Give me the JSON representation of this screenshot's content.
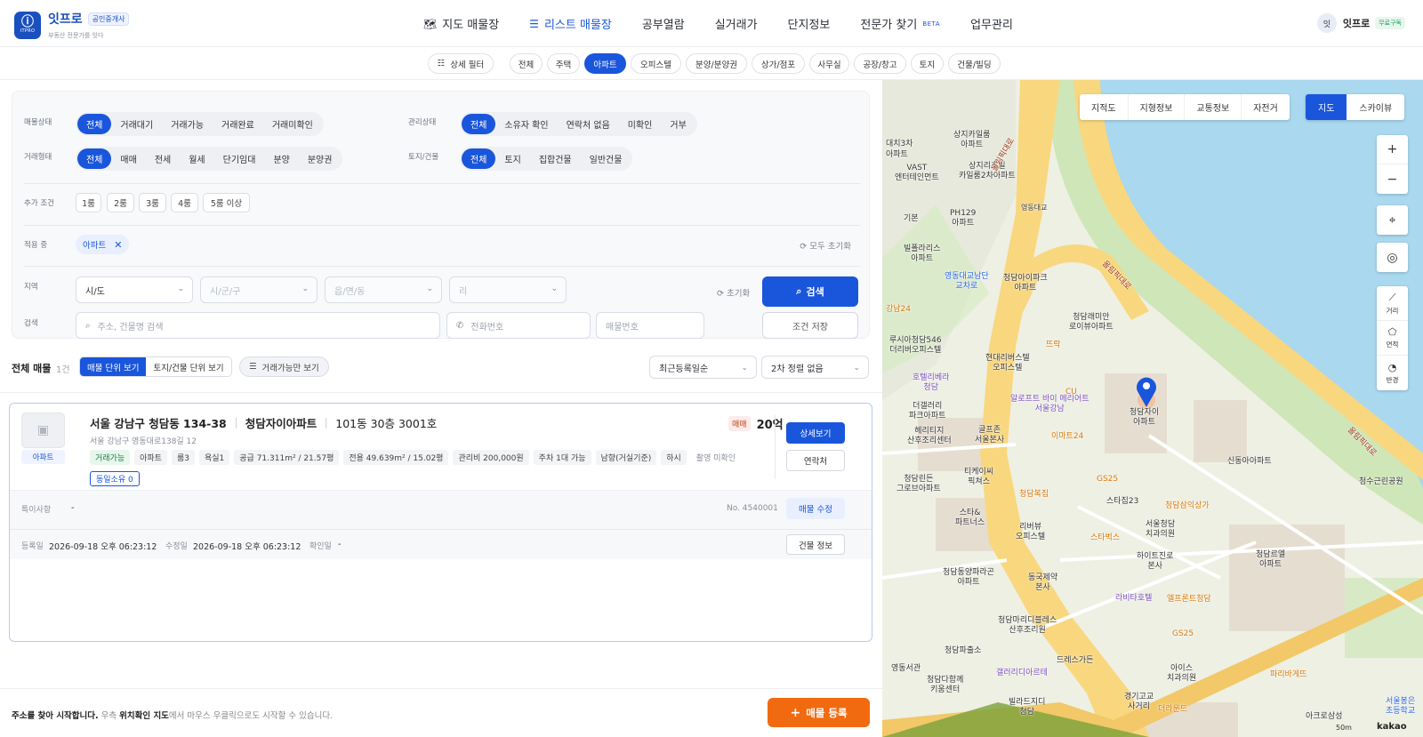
{
  "brand": {
    "name": "잇프로",
    "badge": "공인중개사",
    "tagline": "부동산 전문가를 잇다",
    "logo_text": "ITPRO"
  },
  "nav": [
    {
      "label": "지도 매물장",
      "icon": "map-icon"
    },
    {
      "label": "리스트 매물장",
      "icon": "list-icon",
      "active": true
    },
    {
      "label": "공부열람"
    },
    {
      "label": "실거래가"
    },
    {
      "label": "단지정보"
    },
    {
      "label": "전문가 찾기",
      "badge": "BETA"
    },
    {
      "label": "업무관리"
    }
  ],
  "user": {
    "avatar": "잇",
    "name": "잇프로",
    "plan": "무료구독"
  },
  "categories": {
    "detail_filter": "상세 필터",
    "items": [
      "전체",
      "주택",
      "아파트",
      "오피스텔",
      "분양/분양권",
      "상가/점포",
      "사무실",
      "공장/창고",
      "토지",
      "건물/빌딩"
    ],
    "active": "아파트"
  },
  "filters": {
    "status": {
      "label": "매물상태",
      "options": [
        "전체",
        "거래대기",
        "거래가능",
        "거래완료",
        "거래미확인"
      ]
    },
    "manage": {
      "label": "관리상태",
      "options": [
        "전체",
        "소유자 확인",
        "연락처 없음",
        "미확인",
        "거부"
      ]
    },
    "deal": {
      "label": "거래형태",
      "options": [
        "전체",
        "매매",
        "전세",
        "월세",
        "단기임대",
        "분양",
        "분양권"
      ]
    },
    "land": {
      "label": "토지/건물",
      "options": [
        "전체",
        "토지",
        "집합건물",
        "일반건물"
      ]
    },
    "extra": {
      "label": "추가 조건",
      "rooms": [
        "1룸",
        "2룸",
        "3룸",
        "4룸",
        "5룸 이상"
      ]
    },
    "applied": {
      "label": "적용 중",
      "tag": "아파트",
      "reset_all": "모두 초기화"
    },
    "region": {
      "label": "지역",
      "sido": "시/도",
      "sigungu": "시/군/구",
      "dong": "읍/면/동",
      "ri": "리",
      "reset": "초기화",
      "search_btn": "검색"
    },
    "search": {
      "label": "검색",
      "address_ph": "주소, 건물명 검색",
      "phone_ph": "전화번호",
      "number_ph": "매물번호",
      "save_btn": "조건 저장"
    }
  },
  "list": {
    "title": "전체 매물",
    "count": "1건",
    "view_unit": "매물 단위 보기",
    "view_building": "토지/건물 단위 보기",
    "available_only": "거래가능만 보기",
    "sort1": "최근등록일순",
    "sort2": "2차 정렬 없음"
  },
  "listing": {
    "thumb_tag": "아파트",
    "address": "서울 강남구 청담동 134-38",
    "complex": "청담자이아파트",
    "unit": "101동 30층 3001호",
    "road_address": "서울 강남구 영동대로138길 12",
    "deal_type": "매매",
    "price": "20억",
    "tags": [
      "거래가능",
      "아파트",
      "룸3",
      "욕실1",
      "공급 71.311m² / 21.57평",
      "전용 49.639m² / 15.02평",
      "관리비 200,000원",
      "주차 1대 가능",
      "남향(거실기준)",
      "하시",
      "촬영 미확인"
    ],
    "owner": "동일소유 0",
    "detail_btn": "상세보기",
    "contact_btn": "연락처",
    "notes_label": "특이사항",
    "notes_value": "-",
    "listing_no": "No. 4540001",
    "edit_btn": "매물 수정",
    "registered_label": "등록일",
    "registered": "2026-09-18 오후 06:23:12",
    "modified_label": "수정일",
    "modified": "2026-09-18 오후 06:23:12",
    "confirmed_label": "확인일",
    "confirmed": "-",
    "building_btn": "건물 정보"
  },
  "footer": {
    "hint_bold": "주소를 찾아 시작합니다.",
    "hint_pre": "우측",
    "hint_map": "위치확인 지도",
    "hint_post": "에서 마우스 우클릭으로도 시작할 수 있습니다.",
    "register_btn": "매물 등록"
  },
  "map": {
    "layers": [
      "지적도",
      "지형정보",
      "교통정보",
      "자전거"
    ],
    "modes": [
      "지도",
      "스카이뷰"
    ],
    "controls": {
      "zoom_in": "+",
      "zoom_out": "−",
      "distance": "거리",
      "area": "면적",
      "radius": "반경"
    },
    "scale": "50m",
    "provider": "kakao",
    "labels": [
      {
        "text": "상지카일룸\n아파트",
        "kind": ""
      },
      {
        "text": "VAST\n엔터테인먼트",
        "kind": ""
      },
      {
        "text": "상지리츠빌\n카일룸2차아파트",
        "kind": ""
      },
      {
        "text": "영동대교",
        "kind": ""
      },
      {
        "text": "PH129\n아파트",
        "kind": ""
      },
      {
        "text": "기본",
        "kind": ""
      },
      {
        "text": "빌폴라리스\n아파트",
        "kind": ""
      },
      {
        "text": "영동대교남단\n교차로",
        "kind": ""
      },
      {
        "text": "청담아이파크\n아파트",
        "kind": ""
      },
      {
        "text": "청담래미안\n로이뷰아파트",
        "kind": ""
      },
      {
        "text": "루시아청담546\n더리버오피스텔",
        "kind": ""
      },
      {
        "text": "현대리버스텔\n오피스텔",
        "kind": ""
      },
      {
        "text": "뜨락",
        "kind": "orange"
      },
      {
        "text": "호텔리베라\n청담",
        "kind": "purple"
      },
      {
        "text": "알로프트 바이 메리어트\n서울강남",
        "kind": "purple"
      },
      {
        "text": "CU",
        "kind": "orange"
      },
      {
        "text": "청담자이\n아파트",
        "kind": ""
      },
      {
        "text": "더갤러리\n파크아파트",
        "kind": ""
      },
      {
        "text": "골프존\n서울본사",
        "kind": ""
      },
      {
        "text": "이마트24",
        "kind": "orange"
      },
      {
        "text": "헤리티지\n산후조리센터",
        "kind": ""
      },
      {
        "text": "신동아아파트",
        "kind": ""
      },
      {
        "text": "청수근린공원",
        "kind": ""
      },
      {
        "text": "티케이씨\n픽쳐스",
        "kind": ""
      },
      {
        "text": "청담린든\n그로브아파트",
        "kind": ""
      },
      {
        "text": "GS25",
        "kind": "orange"
      },
      {
        "text": "청담복집",
        "kind": "orange"
      },
      {
        "text": "스타집23",
        "kind": ""
      },
      {
        "text": "청담삼익상가",
        "kind": "orange"
      },
      {
        "text": "스타&\n파트너스",
        "kind": ""
      },
      {
        "text": "리버뷰\n오피스텔",
        "kind": ""
      },
      {
        "text": "스타벅스",
        "kind": "orange"
      },
      {
        "text": "서울청담\n치과의원",
        "kind": ""
      },
      {
        "text": "청담르엘\n아파트",
        "kind": ""
      },
      {
        "text": "하이트진로\n본사",
        "kind": ""
      },
      {
        "text": "청담동양파라곤\n아파트",
        "kind": ""
      },
      {
        "text": "동국제약\n본사",
        "kind": ""
      },
      {
        "text": "라비타호텔",
        "kind": "purple"
      },
      {
        "text": "엘프론트청담",
        "kind": "orange"
      },
      {
        "text": "청담마리디블레스\n산후조리원",
        "kind": ""
      },
      {
        "text": "GS25",
        "kind": "orange"
      },
      {
        "text": "청담파출소",
        "kind": ""
      },
      {
        "text": "드레스가든",
        "kind": ""
      },
      {
        "text": "갤러리디아르테",
        "kind": "purple"
      },
      {
        "text": "아이스\n치과의원",
        "kind": ""
      },
      {
        "text": "파리바게뜨",
        "kind": "orange"
      },
      {
        "text": "영동서관",
        "kind": ""
      },
      {
        "text": "청담다함께\n키움센터",
        "kind": ""
      },
      {
        "text": "빌라드지디\n청담",
        "kind": ""
      },
      {
        "text": "경기고교\n사거리",
        "kind": ""
      },
      {
        "text": "더라운드",
        "kind": "orange"
      },
      {
        "text": "아크로삼성",
        "kind": ""
      },
      {
        "text": "서울봉은\n초등학교",
        "kind": ""
      },
      {
        "text": "올림픽대로",
        "kind": "road"
      },
      {
        "text": "올림픽대로",
        "kind": "road"
      },
      {
        "text": "올림픽대로",
        "kind": "road"
      },
      {
        "text": "강남24",
        "kind": "orange"
      },
      {
        "text": "대치3차",
        "kind": ""
      },
      {
        "text": "아파트",
        "kind": ""
      }
    ]
  },
  "colors": {
    "primary": "#1a56db",
    "accent": "#f26a10",
    "river": "#a9d8ef",
    "road": "#f9d77e"
  }
}
